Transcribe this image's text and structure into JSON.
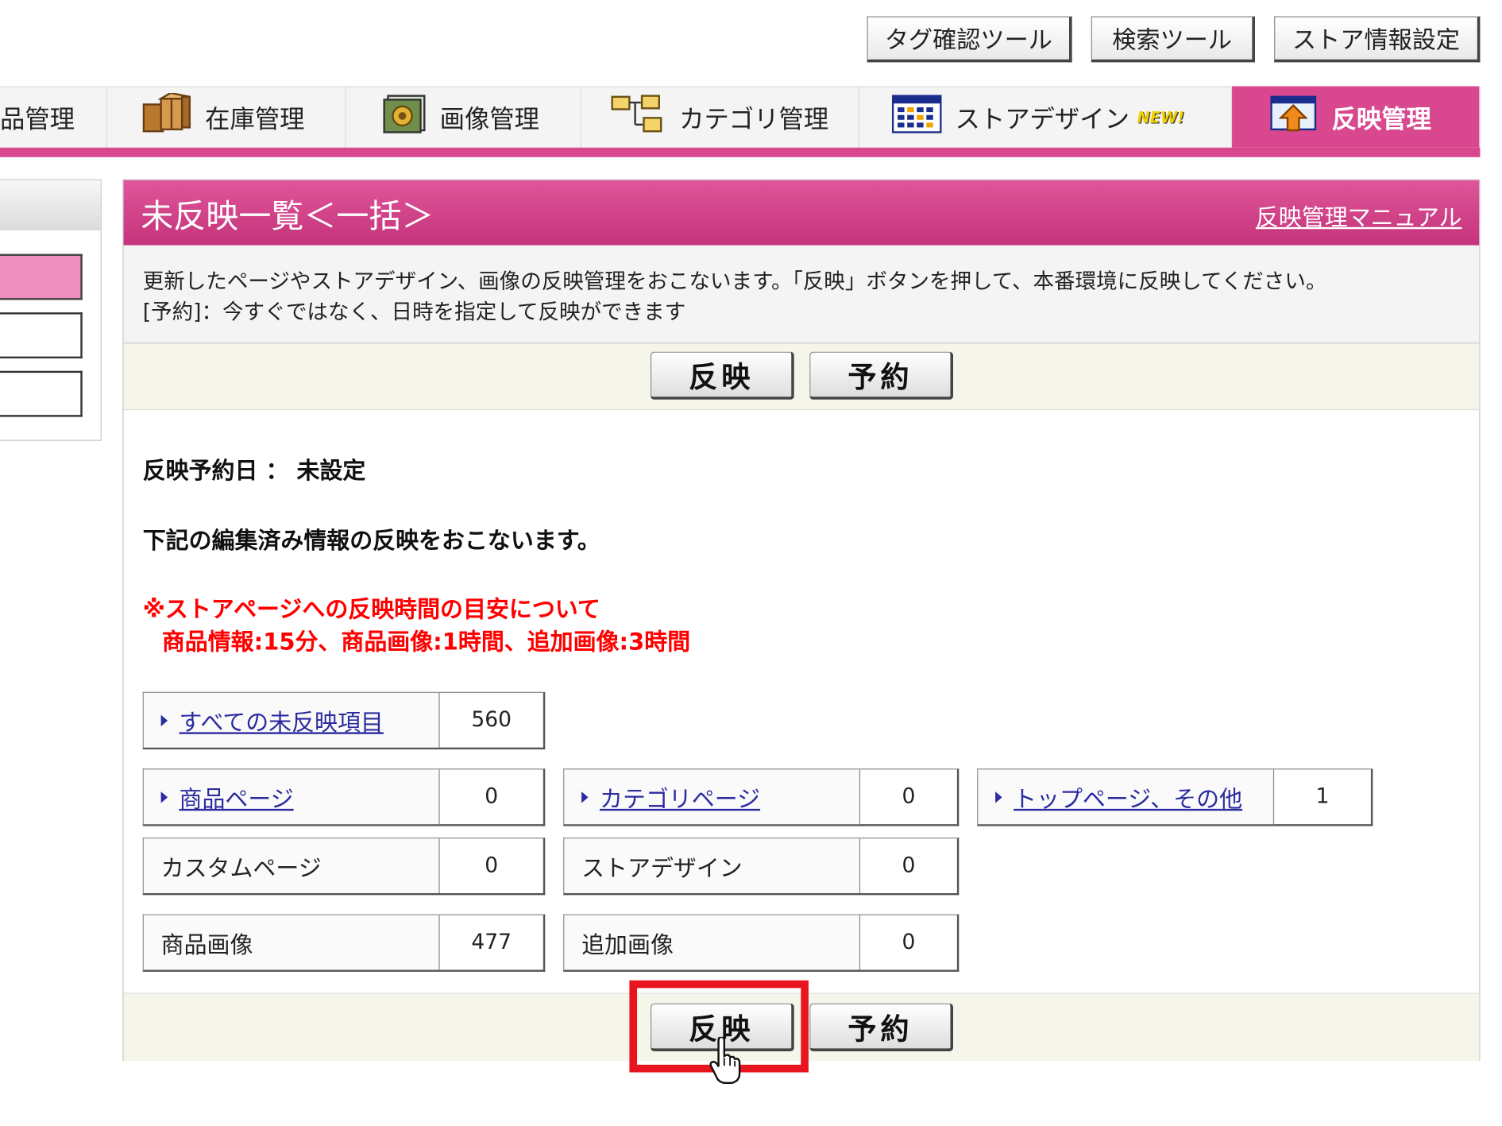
{
  "toolbar": {
    "tag_tool": "タグ確認ツール",
    "search_tool": "検索ツール",
    "store_settings": "ストア情報設定"
  },
  "nav": {
    "tabs": [
      {
        "label": "品管理",
        "icon": "product-icon"
      },
      {
        "label": "在庫管理",
        "icon": "boxes-icon"
      },
      {
        "label": "画像管理",
        "icon": "image-icon"
      },
      {
        "label": "カテゴリ管理",
        "icon": "folder-tree-icon"
      },
      {
        "label": "ストアデザイン",
        "icon": "layout-icon",
        "badge": "NEW!"
      },
      {
        "label": "反映管理",
        "icon": "upload-icon",
        "active": true
      }
    ]
  },
  "panel": {
    "title": "未反映一覧＜一括＞",
    "manual_link": "反映管理マニュアル",
    "description_1": "更新したページやストアデザイン、画像の反映管理をおこないます。「反映」ボタンを押して、本番環境に反映してください。",
    "description_2": "[予約]：今すぐではなく、日時を指定して反映ができます",
    "apply_button": "反映",
    "reserve_button": "予約",
    "reservation_date": "反映予約日 ： 未設定",
    "apply_notice": "下記の編集済み情報の反映をおこないます。",
    "warning_1": "※ストアページへの反映時間の目安について",
    "warning_2": "商品情報:15分、商品画像:1時間、追加画像:3時間"
  },
  "stats": {
    "all_label": "すべての未反映項目",
    "all_value": "560",
    "product_page_label": "商品ページ",
    "product_page_value": "0",
    "category_page_label": "カテゴリページ",
    "category_page_value": "0",
    "top_page_label": "トップページ、その他",
    "top_page_value": "1",
    "custom_page_label": "カスタムページ",
    "custom_page_value": "0",
    "store_design_label": "ストアデザイン",
    "store_design_value": "0",
    "product_image_label": "商品画像",
    "product_image_value": "477",
    "additional_image_label": "追加画像",
    "additional_image_value": "0"
  },
  "colors": {
    "accent": "#d9488f",
    "warning": "#ff0000",
    "link": "#2b2ba0",
    "highlight": "#e8141e"
  }
}
